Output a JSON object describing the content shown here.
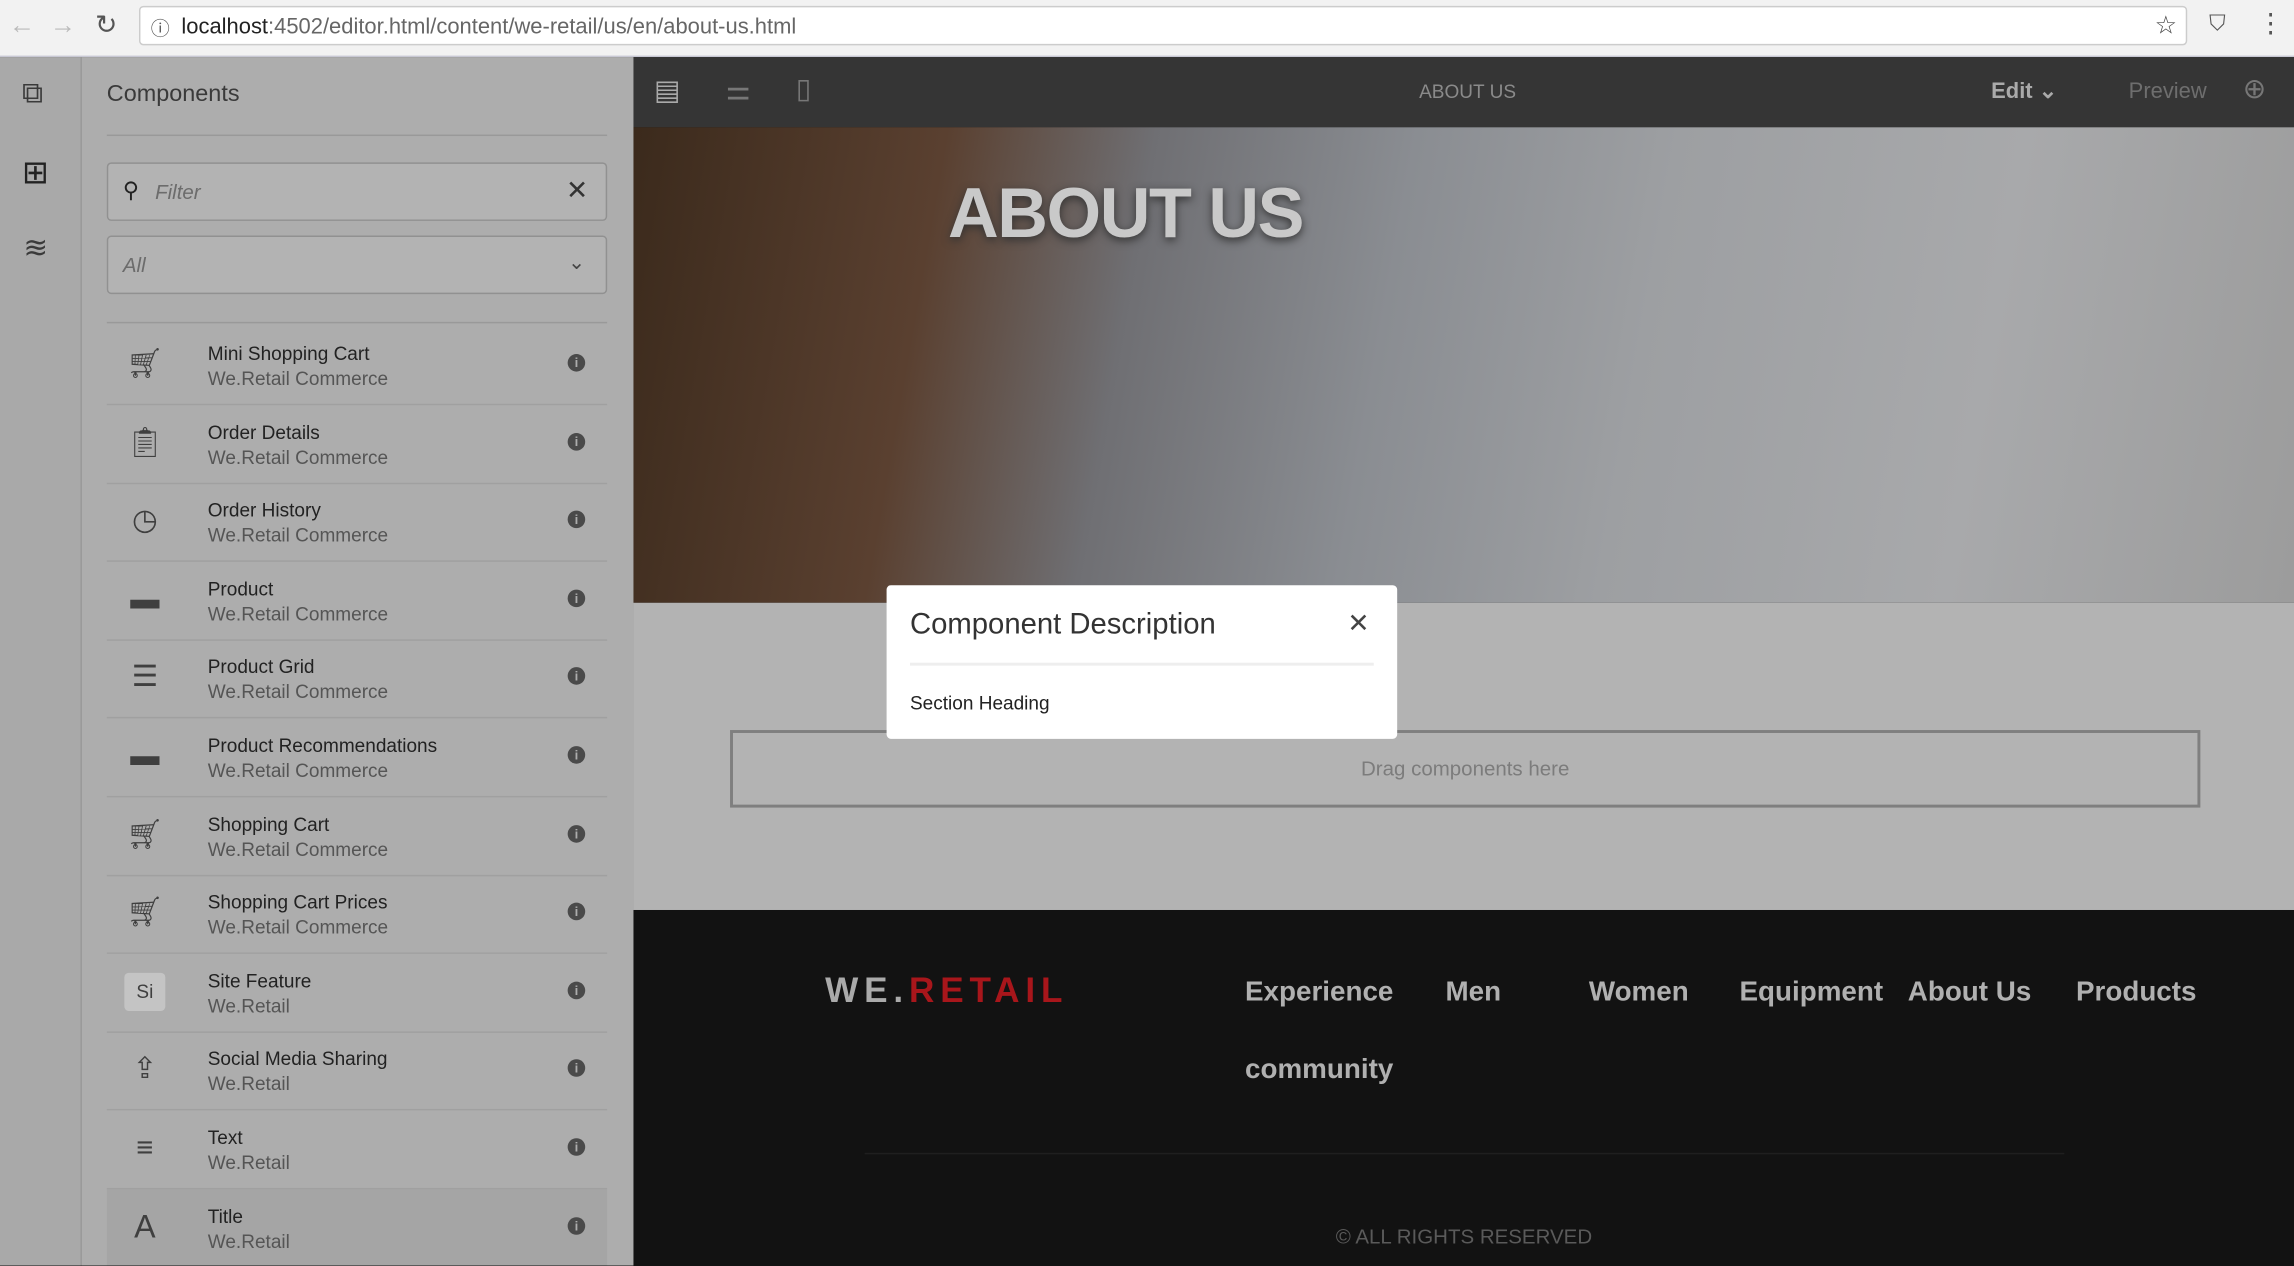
{
  "browser": {
    "url_host": "localhost",
    "url_path": ":4502/editor.html/content/we-retail/us/en/about-us.html"
  },
  "panel": {
    "title": "Components",
    "filter_placeholder": "Filter",
    "group_value": "All",
    "items": [
      {
        "name": "Mini Shopping Cart",
        "group": "We.Retail Commerce",
        "icon": "cart-icon"
      },
      {
        "name": "Order Details",
        "group": "We.Retail Commerce",
        "icon": "clipboard-icon"
      },
      {
        "name": "Order History",
        "group": "We.Retail Commerce",
        "icon": "history-icon"
      },
      {
        "name": "Product",
        "group": "We.Retail Commerce",
        "icon": "archive-icon"
      },
      {
        "name": "Product Grid",
        "group": "We.Retail Commerce",
        "icon": "list-icon"
      },
      {
        "name": "Product Recommendations",
        "group": "We.Retail Commerce",
        "icon": "archive-icon"
      },
      {
        "name": "Shopping Cart",
        "group": "We.Retail Commerce",
        "icon": "cart-icon"
      },
      {
        "name": "Shopping Cart Prices",
        "group": "We.Retail Commerce",
        "icon": "cart-icon"
      },
      {
        "name": "Site Feature",
        "group": "We.Retail",
        "icon": "Si"
      },
      {
        "name": "Social Media Sharing",
        "group": "We.Retail",
        "icon": "share-icon"
      },
      {
        "name": "Text",
        "group": "We.Retail",
        "icon": "text-align-icon"
      },
      {
        "name": "Title",
        "group": "We.Retail",
        "icon": "A"
      }
    ]
  },
  "toolbar": {
    "page_title": "ABOUT US",
    "mode": "Edit",
    "preview": "Preview"
  },
  "page": {
    "hero_title": "ABOUT US",
    "drag_placeholder": "Drag components here",
    "footer": {
      "logo_we": "WE.",
      "logo_retail": "RETAIL",
      "logo_color": "#c4161c",
      "nav": [
        "Experience",
        "Men",
        "Women",
        "Equipment",
        "About Us",
        "Products",
        "community"
      ],
      "copyright": "© ALL RIGHTS RESERVED"
    }
  },
  "dialog": {
    "title": "Component Description",
    "body": "Section Heading"
  }
}
